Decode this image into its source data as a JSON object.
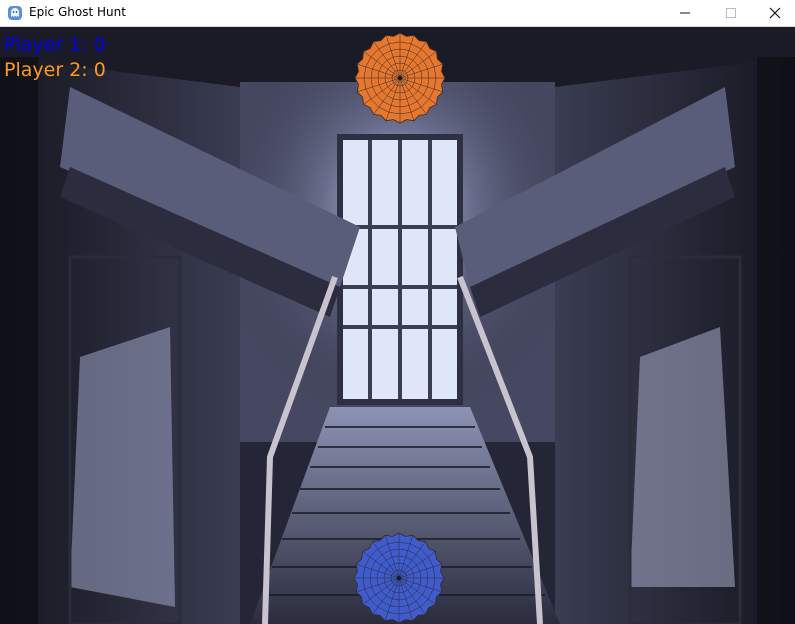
{
  "window": {
    "title": "Epic Ghost Hunt",
    "icon": "ghost-app-icon"
  },
  "hud": {
    "player1": {
      "label": "Player 1: 0",
      "color": "#0000ee"
    },
    "player2": {
      "label": "Player 2: 0",
      "color": "#ff9a1a"
    }
  },
  "paddles": {
    "top": {
      "icon": "spider-web-icon",
      "color": "#e8772e"
    },
    "bottom": {
      "icon": "spider-web-icon",
      "color": "#3f5bcc"
    }
  }
}
